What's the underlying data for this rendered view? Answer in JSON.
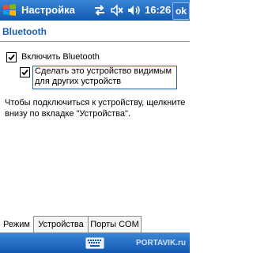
{
  "titlebar": {
    "title": "Настройка",
    "time": "16:26",
    "ok_label": "ok",
    "icons": [
      "windows-start-icon",
      "connectivity-icon",
      "speaker-muted-icon",
      "volume-icon"
    ]
  },
  "page": {
    "heading": "Bluetooth"
  },
  "options": {
    "enable_bluetooth": {
      "label": "Включить Bluetooth",
      "checked": true
    },
    "visible": {
      "label_line1": "Сделать это устройство видимым",
      "label_line2": "для других устройств",
      "checked": true
    }
  },
  "info": {
    "text": "Чтобы подключиться к устройству, щелкните внизу по вкладке \"Устройства\"."
  },
  "tabs": [
    {
      "label": "Режим",
      "active": true
    },
    {
      "label": "Устройства",
      "active": false
    },
    {
      "label": "Порты COM",
      "active": false
    }
  ],
  "menubar": {
    "watermark": "PORTAVIK.ru"
  },
  "colors": {
    "bar_blue": "#1f6dc4",
    "heading_blue": "#1a5fb0"
  }
}
